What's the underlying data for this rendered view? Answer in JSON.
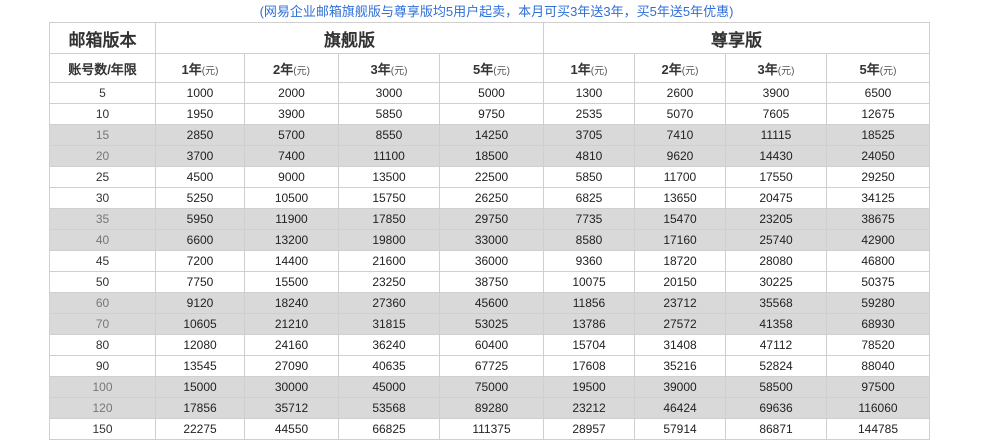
{
  "notice": "(网易企业邮箱旗舰版与尊享版均5用户起卖，本月可买3年送3年，买5年送5年优惠)",
  "headers": {
    "edition": "邮箱版本",
    "accounts": "账号数/年限",
    "flagship": "旗舰版",
    "premium": "尊享版",
    "years": [
      {
        "y": "1年",
        "u": "(元)"
      },
      {
        "y": "2年",
        "u": "(元)"
      },
      {
        "y": "3年",
        "u": "(元)"
      },
      {
        "y": "5年",
        "u": "(元)"
      }
    ]
  },
  "rows": [
    {
      "acc": "5",
      "f": [
        "1000",
        "2000",
        "3000",
        "5000"
      ],
      "p": [
        "1300",
        "2600",
        "3900",
        "6500"
      ],
      "shade": false
    },
    {
      "acc": "10",
      "f": [
        "1950",
        "3900",
        "5850",
        "9750"
      ],
      "p": [
        "2535",
        "5070",
        "7605",
        "12675"
      ],
      "shade": false
    },
    {
      "acc": "15",
      "f": [
        "2850",
        "5700",
        "8550",
        "14250"
      ],
      "p": [
        "3705",
        "7410",
        "11115",
        "18525"
      ],
      "shade": true
    },
    {
      "acc": "20",
      "f": [
        "3700",
        "7400",
        "11100",
        "18500"
      ],
      "p": [
        "4810",
        "9620",
        "14430",
        "24050"
      ],
      "shade": true
    },
    {
      "acc": "25",
      "f": [
        "4500",
        "9000",
        "13500",
        "22500"
      ],
      "p": [
        "5850",
        "11700",
        "17550",
        "29250"
      ],
      "shade": false
    },
    {
      "acc": "30",
      "f": [
        "5250",
        "10500",
        "15750",
        "26250"
      ],
      "p": [
        "6825",
        "13650",
        "20475",
        "34125"
      ],
      "shade": false
    },
    {
      "acc": "35",
      "f": [
        "5950",
        "11900",
        "17850",
        "29750"
      ],
      "p": [
        "7735",
        "15470",
        "23205",
        "38675"
      ],
      "shade": true
    },
    {
      "acc": "40",
      "f": [
        "6600",
        "13200",
        "19800",
        "33000"
      ],
      "p": [
        "8580",
        "17160",
        "25740",
        "42900"
      ],
      "shade": true
    },
    {
      "acc": "45",
      "f": [
        "7200",
        "14400",
        "21600",
        "36000"
      ],
      "p": [
        "9360",
        "18720",
        "28080",
        "46800"
      ],
      "shade": false
    },
    {
      "acc": "50",
      "f": [
        "7750",
        "15500",
        "23250",
        "38750"
      ],
      "p": [
        "10075",
        "20150",
        "30225",
        "50375"
      ],
      "shade": false
    },
    {
      "acc": "60",
      "f": [
        "9120",
        "18240",
        "27360",
        "45600"
      ],
      "p": [
        "11856",
        "23712",
        "35568",
        "59280"
      ],
      "shade": true
    },
    {
      "acc": "70",
      "f": [
        "10605",
        "21210",
        "31815",
        "53025"
      ],
      "p": [
        "13786",
        "27572",
        "41358",
        "68930"
      ],
      "shade": true
    },
    {
      "acc": "80",
      "f": [
        "12080",
        "24160",
        "36240",
        "60400"
      ],
      "p": [
        "15704",
        "31408",
        "47112",
        "78520"
      ],
      "shade": false
    },
    {
      "acc": "90",
      "f": [
        "13545",
        "27090",
        "40635",
        "67725"
      ],
      "p": [
        "17608",
        "35216",
        "52824",
        "88040"
      ],
      "shade": false
    },
    {
      "acc": "100",
      "f": [
        "15000",
        "30000",
        "45000",
        "75000"
      ],
      "p": [
        "19500",
        "39000",
        "58500",
        "97500"
      ],
      "shade": true
    },
    {
      "acc": "120",
      "f": [
        "17856",
        "35712",
        "53568",
        "89280"
      ],
      "p": [
        "23212",
        "46424",
        "69636",
        "116060"
      ],
      "shade": true
    },
    {
      "acc": "150",
      "f": [
        "22275",
        "44550",
        "66825",
        "111375"
      ],
      "p": [
        "28957",
        "57914",
        "86871",
        "144785"
      ],
      "shade": false
    }
  ]
}
